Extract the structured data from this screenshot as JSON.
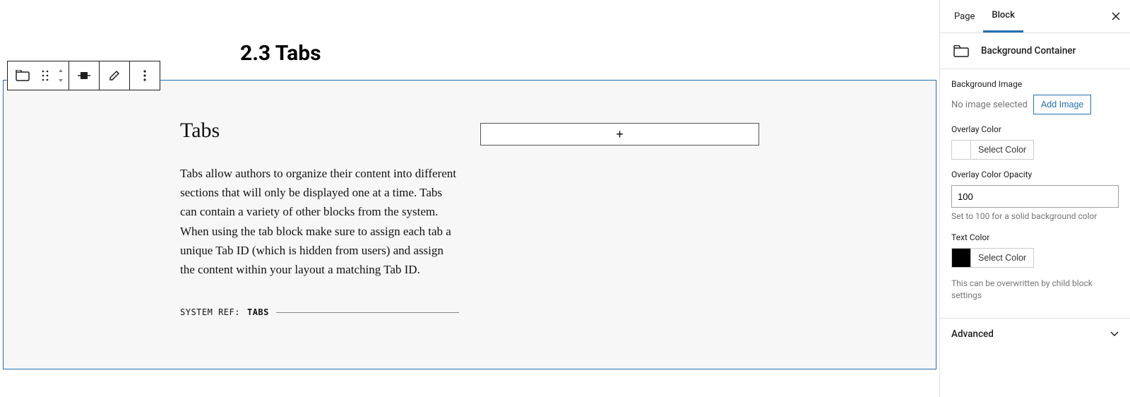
{
  "editor": {
    "page_title": "2.3 Tabs",
    "content": {
      "heading": "Tabs",
      "body": "Tabs allow authors to organize their content into different sections that will only be displayed one at a time. Tabs can contain a variety of other blocks from the system. When using the tab block make sure to assign each tab a unique Tab ID (which is hidden from users) and assign the content within your layout a matching Tab ID.",
      "system_ref_label": "SYSTEM REF:",
      "system_ref_value": "TABS"
    },
    "add_block_glyph": "+"
  },
  "toolbar": {
    "icon_block_type": "folder-icon",
    "icon_drag": "drag-icon",
    "icon_movers": "movers-icon",
    "icon_align": "align-icon",
    "icon_edit": "pencil-icon",
    "icon_more": "more-vertical-icon"
  },
  "sidebar": {
    "tabs": [
      {
        "label": "Page",
        "active": false
      },
      {
        "label": "Block",
        "active": true
      }
    ],
    "block_type": {
      "label": "Background Container"
    },
    "panels": {
      "bg_image": {
        "title": "Background Image",
        "status": "No image selected",
        "button": "Add Image"
      },
      "overlay_color": {
        "title": "Overlay Color",
        "button": "Select Color"
      },
      "overlay_opacity": {
        "title": "Overlay Color Opacity",
        "value": "100",
        "help": "Set to 100 for a solid background color"
      },
      "text_color": {
        "title": "Text Color",
        "swatch": "#000000",
        "button": "Select Color",
        "help": "This can be overwritten by child block settings"
      },
      "advanced": {
        "title": "Advanced"
      }
    }
  }
}
